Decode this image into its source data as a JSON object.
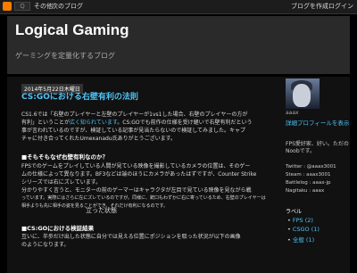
{
  "navbar": {
    "logo_label": "B",
    "search_label": "Q",
    "more_label": "その他",
    "next_blog_label": "次のブログ",
    "create_blog_label": "ブログを作成",
    "login_label": "ログイン"
  },
  "header": {
    "title": "Logical Gaming",
    "description": "ゲーミングを定量化するブログ"
  },
  "post": {
    "date": "2014年5月22日木曜日",
    "title": "CS:GOにおける右壁有利の法則",
    "intro_1": "CS1.6では「右壁のプレイヤーと左壁のプレイヤーが1vs1した場合、右壁のプレイヤーの方が",
    "intro_2a": "有利」ということが",
    "intro_2_link": "広く知られています",
    "intro_2b": "。CS:GOでも前作の仕様を受け継いで右壁有利だという",
    "intro_3": "事が言われているのですが、検証している記事が見当たらないので検証してみました。キャプ",
    "intro_4": "チャに付き合ってくれたUmexanadu氏ありがとうございます。",
    "section_1_heading": "■そもそもなぜ右壁有利なのか？",
    "section_1_l1": "FPSでのゲームをプレイしている人間が見ている映像を撮影しているカメラの位置は、そのゲー",
    "section_1_l2": "ムの仕様によって異なります。BF3などは端のほうにカメラがあったはずですが、Counter Strike",
    "section_1_l3": "シリーズでは右にズレています。",
    "section_1_l4": "分かりやすく言うと、モニターの前のゲーマーはキャラクタが左目で見ている映像を見ながら戦",
    "section_1_l5": "っています。実際にはさらに左にズレているのですが。同様に、銃口もわずかに右に寄っているため、右壁のプレイヤーは",
    "section_1_l6": "相手よりも先に相手の姿を見ることができ、それだけ有利になるのです。",
    "section_2_heading": "■CS:GOにおける検証結果",
    "section_2_l1": "互いに、半歩だけ出した状態に自分では見える位置にポジションを取った状況が以下の画像",
    "section_2_l2": "のようになります。",
    "caption": "立った状態"
  },
  "sidebar": {
    "profile_name": "aaax",
    "profile_link": "詳細プロフィールを表示",
    "profile_desc": "FPS愛好家、好い。ただのNoobです。",
    "twitter": "Twitter : @aaax3001",
    "steam": "Steam : aaax3001",
    "battlelog": "Battlelog : aaax-jp",
    "nagitaku": "Nagitaku : aaax",
    "labels_heading": "ラベル",
    "labels": [
      "FPS (2)",
      "CSGO (1)",
      "全般 (1)"
    ]
  }
}
